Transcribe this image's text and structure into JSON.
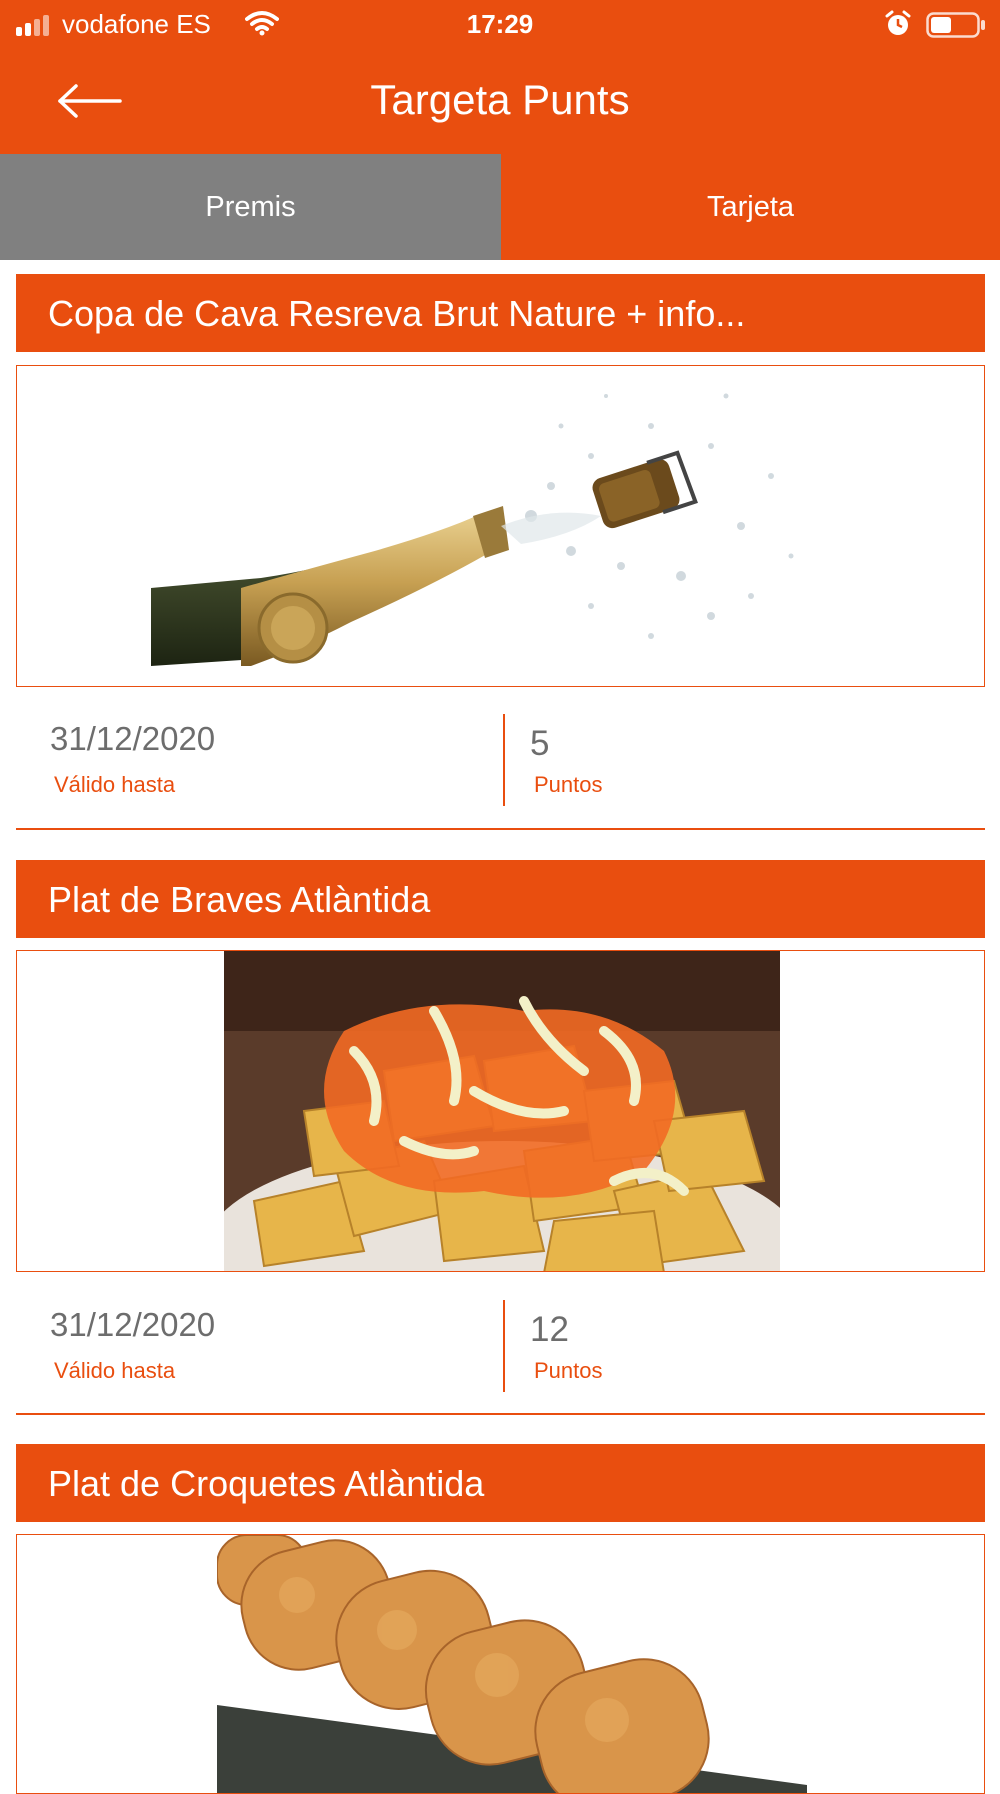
{
  "status_bar": {
    "carrier": "vodafone ES",
    "time": "17:29",
    "signal_icon": "signal-bars-icon",
    "wifi_icon": "wifi-icon",
    "alarm_icon": "alarm-icon",
    "battery_icon": "battery-icon",
    "battery_level": 0.45
  },
  "header": {
    "title": "Targeta Punts",
    "back_icon": "arrow-left-icon"
  },
  "tabs": [
    {
      "label": "Premis",
      "selected": true
    },
    {
      "label": "Tarjeta",
      "selected": false
    }
  ],
  "colors": {
    "accent": "#E94E0F",
    "tab_selected": "#808080",
    "text_gray": "#6d6d6d"
  },
  "rewards": [
    {
      "title": "Copa de Cava Resreva Brut Nature  + info...",
      "image": "champagne-bottle-image",
      "date": "31/12/2020",
      "date_label": "Válido hasta",
      "points": "5",
      "points_label": "Puntos"
    },
    {
      "title": "Plat de Braves Atlàntida",
      "image": "patatas-bravas-image",
      "date": "31/12/2020",
      "date_label": "Válido hasta",
      "points": "12",
      "points_label": "Puntos"
    },
    {
      "title": "Plat de Croquetes Atlàntida",
      "image": "croquetas-image"
    }
  ]
}
